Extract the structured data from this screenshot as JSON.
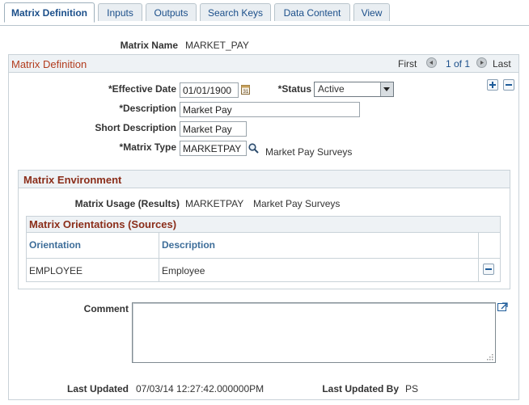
{
  "tabs": [
    {
      "label": "Matrix Definition",
      "active": true
    },
    {
      "label": "Inputs",
      "active": false
    },
    {
      "label": "Outputs",
      "active": false
    },
    {
      "label": "Search Keys",
      "active": false
    },
    {
      "label": "Data Content",
      "active": false
    },
    {
      "label": "View",
      "active": false
    }
  ],
  "header": {
    "matrix_name_label": "Matrix Name",
    "matrix_name_value": "MARKET_PAY"
  },
  "definition": {
    "title": "Matrix Definition",
    "nav": {
      "first": "First",
      "count": "1 of 1",
      "last": "Last"
    },
    "effective_date_label": "*Effective Date",
    "effective_date_value": "01/01/1900",
    "status_label": "*Status",
    "status_value": "Active",
    "description_label": "*Description",
    "description_value": "Market Pay",
    "short_description_label": "Short Description",
    "short_description_value": "Market Pay",
    "matrix_type_label": "*Matrix Type",
    "matrix_type_value": "MARKETPAY",
    "matrix_type_desc": "Market Pay Surveys"
  },
  "environment": {
    "title": "Matrix Environment",
    "usage_label": "Matrix Usage (Results)",
    "usage_value": "MARKETPAY",
    "usage_desc": "Market Pay Surveys"
  },
  "orientations": {
    "title": "Matrix Orientations (Sources)",
    "columns": {
      "orientation": "Orientation",
      "description": "Description"
    },
    "rows": [
      {
        "orientation": "EMPLOYEE",
        "description": "Employee"
      }
    ]
  },
  "comment": {
    "label": "Comment",
    "value": ""
  },
  "footer": {
    "last_updated_label": "Last Updated",
    "last_updated_value": "07/03/14 12:27:42.000000PM",
    "last_updated_by_label": "Last Updated By",
    "last_updated_by_value": "PS"
  },
  "colors": {
    "accent": "#1b4f8a",
    "section_title": "#b23c1e",
    "subsection_title": "#8b2e1a",
    "column_header": "#3d6d99"
  },
  "icons": [
    "calendar-icon",
    "lookup-magnifier-icon",
    "add-row-icon",
    "delete-row-icon",
    "expand-icon",
    "previous-icon",
    "next-icon"
  ]
}
